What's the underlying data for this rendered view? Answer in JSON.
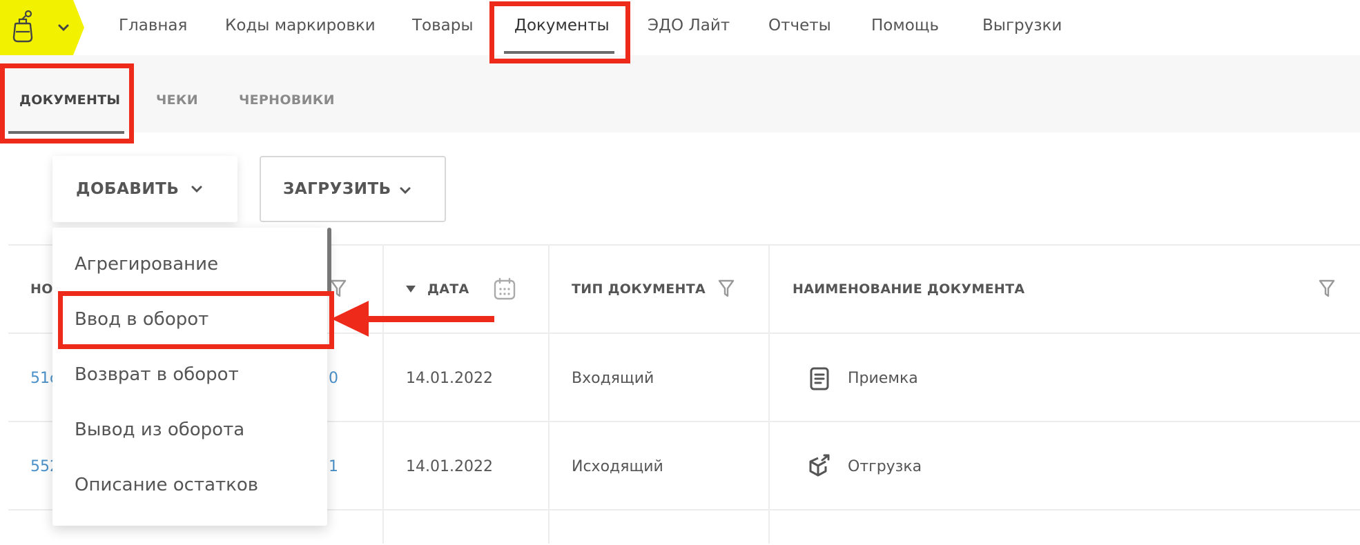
{
  "topnav": {
    "items": [
      {
        "label": "Главная"
      },
      {
        "label": "Коды маркировки"
      },
      {
        "label": "Товары"
      },
      {
        "label": "Документы"
      },
      {
        "label": "ЭДО Лайт"
      },
      {
        "label": "Отчеты"
      },
      {
        "label": "Помощь"
      },
      {
        "label": "Выгрузки"
      }
    ],
    "active_index": 3
  },
  "subtabs": [
    {
      "label": "ДОКУМЕНТЫ"
    },
    {
      "label": "ЧЕКИ"
    },
    {
      "label": "ЧЕРНОВИКИ"
    }
  ],
  "toolbar": {
    "add_label": "ДОБАВИТЬ",
    "load_label": "ЗАГРУЗИТЬ"
  },
  "dropdown": {
    "items": [
      {
        "label": "Агрегирование"
      },
      {
        "label": "Ввод в оборот"
      },
      {
        "label": "Возврат в оборот"
      },
      {
        "label": "Вывод из оборота"
      },
      {
        "label": "Описание остатков"
      }
    ],
    "highlighted_index": 1
  },
  "table": {
    "headers": {
      "number": "НО",
      "date": "ДАТА",
      "doc_type": "ТИП ДОКУМЕНТА",
      "doc_name": "НАИМЕНОВАНИЕ ДОКУМЕНТА"
    },
    "rows": [
      {
        "number_start": "51c",
        "number_end": "0",
        "date": "14.01.2022",
        "doc_type": "Входящий",
        "doc_name": "Приемка",
        "icon": "document-icon"
      },
      {
        "number_start": "552",
        "number_end": "1",
        "date": "14.01.2022",
        "doc_type": "Исходящий",
        "doc_name": "Отгрузка",
        "icon": "box-export-icon"
      }
    ]
  },
  "colors": {
    "logo_bg": "#f2f200",
    "highlight": "#ee2a1a",
    "link": "#4a90c8"
  }
}
